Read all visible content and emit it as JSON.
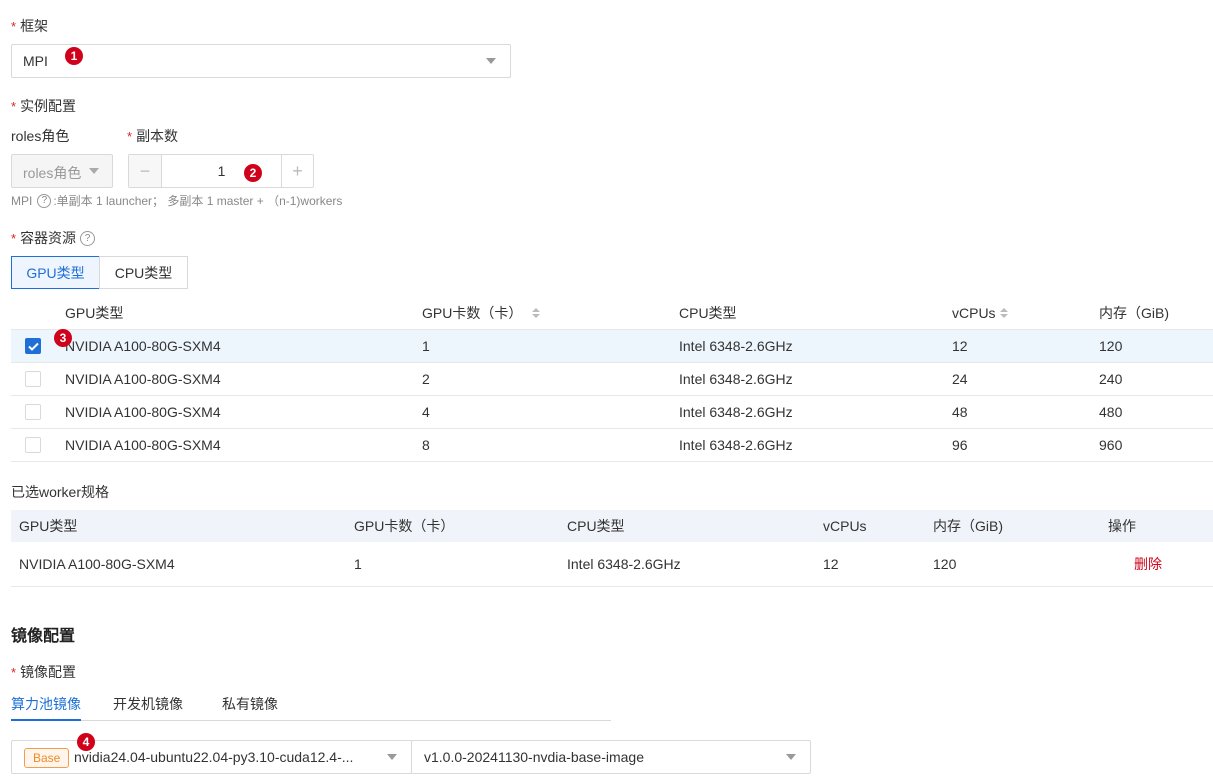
{
  "framework": {
    "label": "框架",
    "value": "MPI",
    "badge": "1"
  },
  "instance": {
    "label": "实例配置",
    "roles_label": "roles角色",
    "roles_placeholder": "roles角色",
    "replicas_label": "副本数",
    "replicas_value": "1",
    "replicas_badge": "2",
    "minus": "−",
    "plus": "+",
    "hint_prefix": "MPI",
    "hint_text": ":单副本 1 launcher； 多副本 1 master + （n-1)workers"
  },
  "resources": {
    "label": "容器资源",
    "tabs": [
      "GPU类型",
      "CPU类型"
    ],
    "active_tab": 0,
    "columns": [
      "GPU类型",
      "GPU卡数（卡）",
      "CPU类型",
      "vCPUs",
      "内存（GiB)"
    ],
    "rows": [
      {
        "gpu": "NVIDIA A100-80G-SXM4",
        "cards": "1",
        "cpu": "Intel 6348-2.6GHz",
        "vcpus": "12",
        "mem": "120",
        "checked": true
      },
      {
        "gpu": "NVIDIA A100-80G-SXM4",
        "cards": "2",
        "cpu": "Intel 6348-2.6GHz",
        "vcpus": "24",
        "mem": "240",
        "checked": false
      },
      {
        "gpu": "NVIDIA A100-80G-SXM4",
        "cards": "4",
        "cpu": "Intel 6348-2.6GHz",
        "vcpus": "48",
        "mem": "480",
        "checked": false
      },
      {
        "gpu": "NVIDIA A100-80G-SXM4",
        "cards": "8",
        "cpu": "Intel 6348-2.6GHz",
        "vcpus": "96",
        "mem": "960",
        "checked": false
      }
    ],
    "row_badge": "3"
  },
  "selected": {
    "label": "已选worker规格",
    "columns": [
      "GPU类型",
      "GPU卡数（卡）",
      "CPU类型",
      "vCPUs",
      "内存（GiB)",
      "操作"
    ],
    "row": {
      "gpu": "NVIDIA A100-80G-SXM4",
      "cards": "1",
      "cpu": "Intel 6348-2.6GHz",
      "vcpus": "12",
      "mem": "120",
      "action": "删除"
    }
  },
  "image": {
    "section_title": "镜像配置",
    "label": "镜像配置",
    "tabs": [
      "算力池镜像",
      "开发机镜像",
      "私有镜像"
    ],
    "active_tab": 0,
    "base_tag": "Base",
    "image_value": "nvidia24.04-ubuntu22.04-py3.10-cuda12.4-...",
    "version_value": "v1.0.0-20241130-nvdia-base-image",
    "badge": "4"
  },
  "colors": {
    "primary": "#1f6fd6",
    "danger": "#d0021b",
    "selected_row_bg": "#eef6fd",
    "header_bg": "#f0f4fa"
  }
}
